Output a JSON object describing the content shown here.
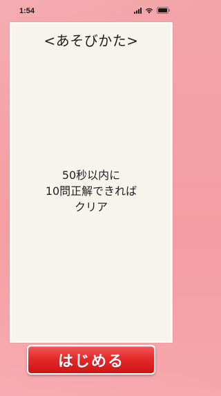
{
  "status_bar": {
    "time": "1:54",
    "icons": [
      "cellular-signal-icon",
      "wifi-icon",
      "battery-icon"
    ]
  },
  "instructions": {
    "title": "<あそびかた>",
    "lines": [
      "50秒以内に",
      "10問正解できれば",
      "クリア"
    ]
  },
  "start_button": {
    "label": "はじめる"
  },
  "colors": {
    "background": "#f7a2a6",
    "card": "#f7f4ee",
    "button": "#e42a2a",
    "button_text": "#ffffff",
    "text": "#1f1f1f"
  }
}
